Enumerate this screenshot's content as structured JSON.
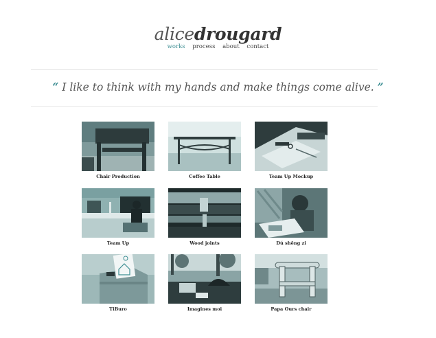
{
  "header": {
    "logo_first": "alice",
    "logo_last": "drougard",
    "nav": [
      {
        "label": "works",
        "active": true
      },
      {
        "label": "process",
        "active": false
      },
      {
        "label": "about",
        "active": false
      },
      {
        "label": "contact",
        "active": false
      }
    ]
  },
  "quote": {
    "open_mark": "“",
    "text": "I like to think with my hands and make things come alive.",
    "close_mark": "”"
  },
  "colors": {
    "accent": "#3f8f94",
    "tint": "#6d8e90"
  },
  "works": [
    {
      "title": "Chair Production",
      "icon": "chair-image"
    },
    {
      "title": "Coffee Table",
      "icon": "table-image"
    },
    {
      "title": "Team Up Mockup",
      "icon": "desk-tools-image"
    },
    {
      "title": "Team Up",
      "icon": "office-image"
    },
    {
      "title": "Wood joints",
      "icon": "wood-joint-image"
    },
    {
      "title": "Dú shēng zi",
      "icon": "child-drawing-image"
    },
    {
      "title": "TiBuro",
      "icon": "cardboard-box-image"
    },
    {
      "title": "Imagines moi",
      "icon": "outdoor-scene-image"
    },
    {
      "title": "Papa Ours chair",
      "icon": "log-chair-image"
    }
  ]
}
